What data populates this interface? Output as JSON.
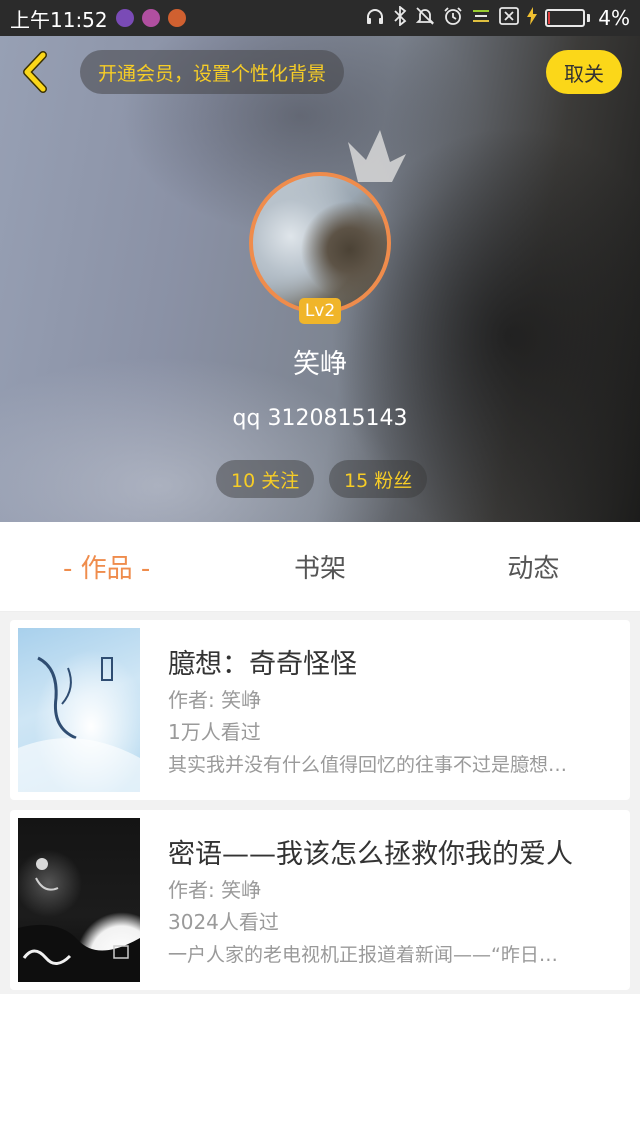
{
  "status_bar": {
    "time": "上午11:52",
    "battery_percent": "4%",
    "battery_level": 0.04,
    "icons": [
      "app-icon",
      "app-icon",
      "app-icon",
      "headphones-icon",
      "bluetooth-icon",
      "mute-icon",
      "alarm-icon",
      "menu-icon",
      "close-box-icon",
      "charging-icon",
      "battery-icon"
    ]
  },
  "header": {
    "vip_prompt": "开通会员，设置个性化背景",
    "unfollow_label": "取关",
    "level": "Lv2",
    "username": "笑峥",
    "qq": "qq 3120815143",
    "following": "10 关注",
    "followers": "15 粉丝"
  },
  "tabs": [
    "- 作品 -",
    "书架",
    "动态"
  ],
  "books": [
    {
      "title": "臆想：奇奇怪怪",
      "author": "作者: 笑峥",
      "reads": "1万人看过",
      "summary": "其实我并没有什么值得回忆的往事不过是臆想…"
    },
    {
      "title": "密语——我该怎么拯救你我的爱人",
      "author": "作者: 笑峥",
      "reads": "3024人看过",
      "summary": "一户人家的老电视机正报道着新闻——“昨日…"
    }
  ],
  "colors": {
    "accent_orange": "#ef8c4c",
    "accent_yellow": "#fbd719",
    "gold_text": "#f7cd26"
  }
}
